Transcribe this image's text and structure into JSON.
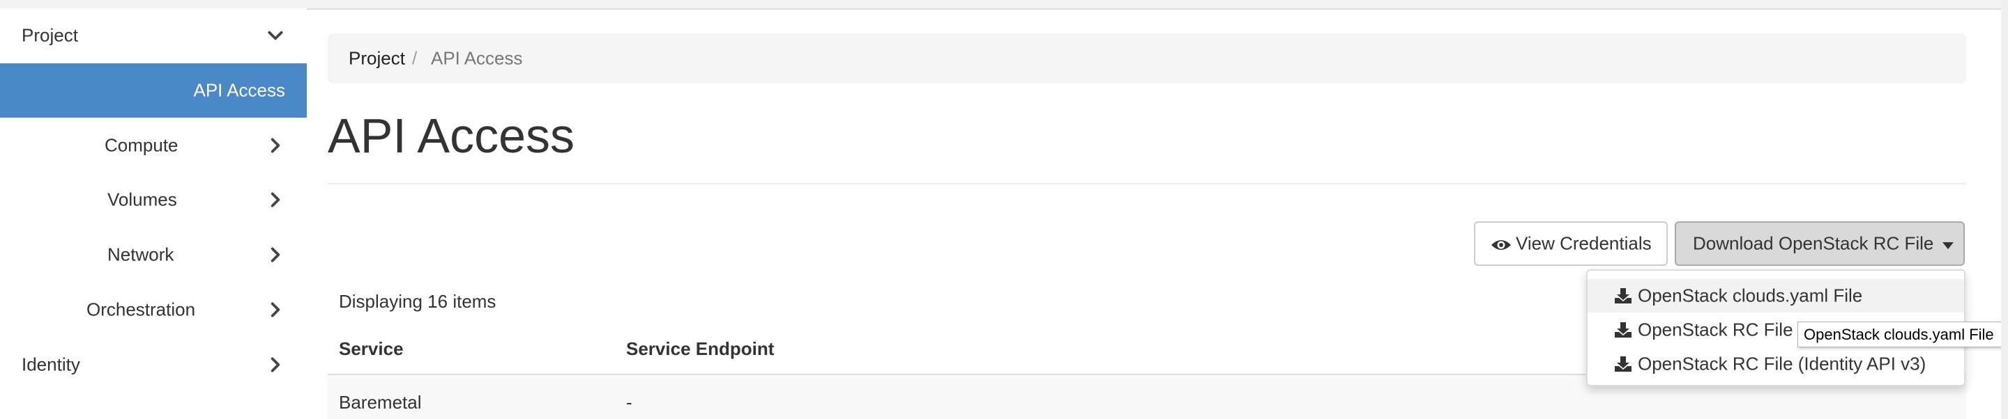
{
  "colors": {
    "sidebar_active": "#4b88c8",
    "breadcrumb_bg": "#f5f5f5",
    "download_button_bg": "#d9d9d9"
  },
  "sidebar": {
    "section": {
      "label": "Project",
      "icon": "chevron-down-icon"
    },
    "items": [
      {
        "label": "API Access",
        "active": true
      },
      {
        "label": "Compute",
        "icon": "chevron-right-icon"
      },
      {
        "label": "Volumes",
        "icon": "chevron-right-icon"
      },
      {
        "label": "Network",
        "icon": "chevron-right-icon"
      },
      {
        "label": "Orchestration",
        "icon": "chevron-right-icon"
      }
    ],
    "next_section": {
      "label": "Identity",
      "icon": "chevron-right-icon"
    }
  },
  "breadcrumb": {
    "items": [
      "Project",
      "API Access"
    ],
    "separator": "/"
  },
  "page": {
    "title": "API Access"
  },
  "toolbar": {
    "view_credentials": {
      "label": "View Credentials",
      "icon": "eye-icon"
    },
    "download_rc": {
      "label": "Download OpenStack RC File",
      "icon": "caret-down-icon"
    }
  },
  "dropdown": {
    "items": [
      {
        "label": "OpenStack clouds.yaml File",
        "icon": "download-icon"
      },
      {
        "label": "OpenStack RC File (",
        "icon": "download-icon"
      },
      {
        "label": "OpenStack RC File (Identity API v3)",
        "icon": "download-icon"
      }
    ]
  },
  "tooltip": {
    "text": "OpenStack clouds.yaml File"
  },
  "table": {
    "count_text": "Displaying 16 items",
    "columns": [
      "Service",
      "Service Endpoint"
    ],
    "rows": [
      [
        "Baremetal",
        "-"
      ]
    ]
  }
}
